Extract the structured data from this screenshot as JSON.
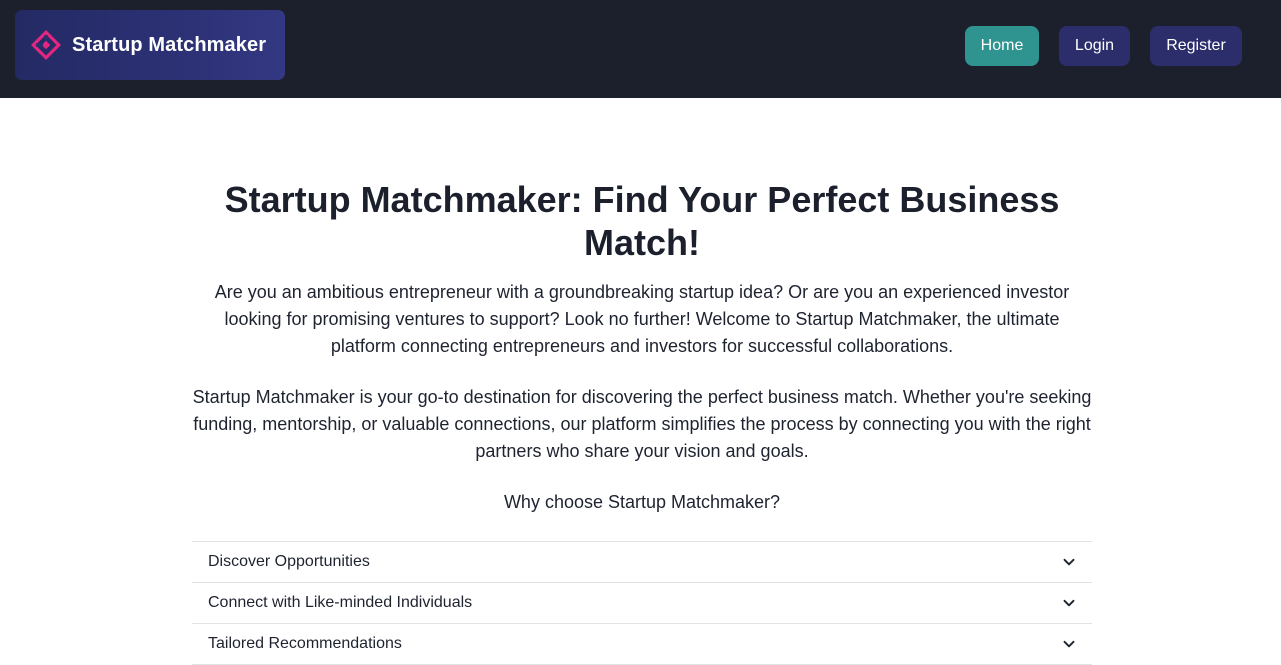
{
  "header": {
    "brand_name": "Startup Matchmaker",
    "nav": {
      "home": "Home",
      "login": "Login",
      "register": "Register"
    },
    "colors": {
      "bar": "#1b202c",
      "home_button": "#2f938f",
      "nav_button": "#2c2e6c",
      "logo_accent": "#e3267f"
    }
  },
  "main": {
    "title": "Startup Matchmaker: Find Your Perfect Business Match!",
    "intro_paragraph": "Are you an ambitious entrepreneur with a groundbreaking startup idea? Or are you an experienced investor looking for promising ventures to support? Look no further! Welcome to Startup Matchmaker, the ultimate platform connecting entrepreneurs and investors for successful collaborations.",
    "description_paragraph": "Startup Matchmaker is your go-to destination for discovering the perfect business match. Whether you're seeking funding, mentorship, or valuable connections, our platform simplifies the process by connecting you with the right partners who share your vision and goals.",
    "why_heading": "Why choose Startup Matchmaker?",
    "accordion": [
      {
        "label": "Discover Opportunities",
        "icon": "chevron-down-icon"
      },
      {
        "label": "Connect with Like-minded Individuals",
        "icon": "chevron-down-icon"
      },
      {
        "label": "Tailored Recommendations",
        "icon": "chevron-down-icon"
      }
    ]
  }
}
